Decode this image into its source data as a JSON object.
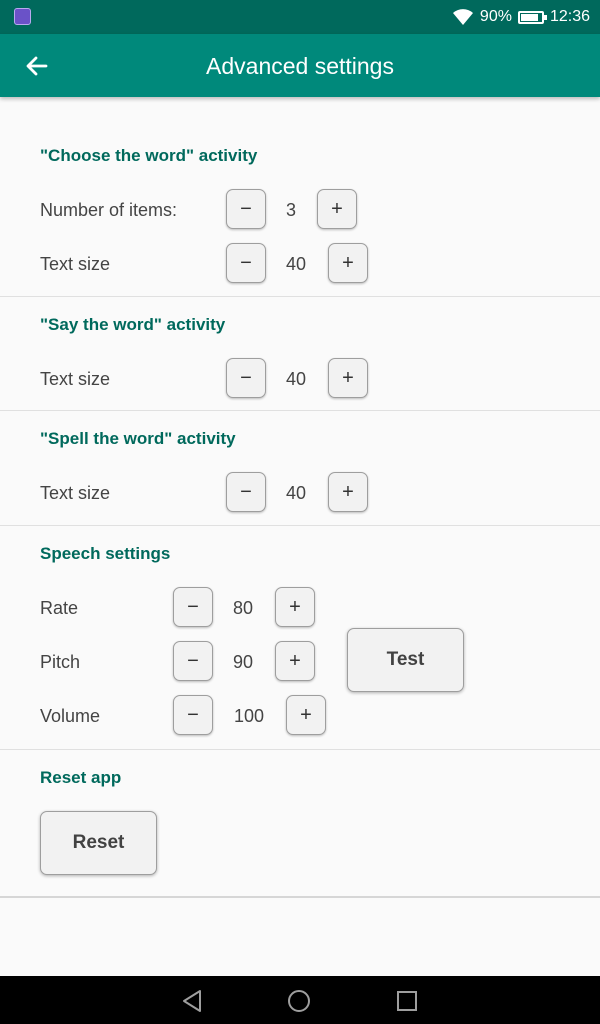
{
  "status": {
    "battery": "90%",
    "time": "12:36"
  },
  "app_bar": {
    "title": "Advanced settings"
  },
  "choose": {
    "title": "\"Choose the word\" activity",
    "items_label": "Number of items:",
    "items_value": "3",
    "text_size_label": "Text size",
    "text_size_value": "40"
  },
  "say": {
    "title": "\"Say the word\" activity",
    "text_size_label": "Text size",
    "text_size_value": "40"
  },
  "spell": {
    "title": "\"Spell the word\" activity",
    "text_size_label": "Text size",
    "text_size_value": "40"
  },
  "speech": {
    "title": "Speech settings",
    "rate_label": "Rate",
    "rate_value": "80",
    "pitch_label": "Pitch",
    "pitch_value": "90",
    "volume_label": "Volume",
    "volume_value": "100",
    "test_label": "Test"
  },
  "reset": {
    "title": "Reset app",
    "button_label": "Reset"
  },
  "controls": {
    "minus": "−",
    "plus": "+"
  }
}
